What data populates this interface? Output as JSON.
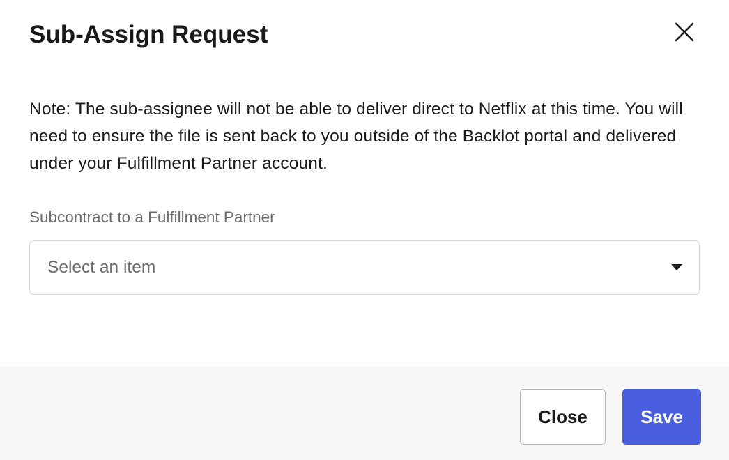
{
  "dialog": {
    "title": "Sub-Assign Request",
    "close_icon": "close-x-icon",
    "note": "Note: The sub-assignee will not be able to deliver direct to Netflix at this time. You will need to ensure the file is sent back to you outside of the Backlot portal and delivered under your Fulfillment Partner account.",
    "field": {
      "label": "Subcontract to a Fulfillment Partner",
      "placeholder": "Select an item",
      "caret_icon": "caret-down-icon"
    },
    "footer": {
      "close_label": "Close",
      "save_label": "Save"
    },
    "colors": {
      "primary": "#4a5ee0",
      "footer_bg": "#f7f7f7",
      "label_text": "#6b6b6b",
      "border": "#d6d6d6"
    }
  }
}
